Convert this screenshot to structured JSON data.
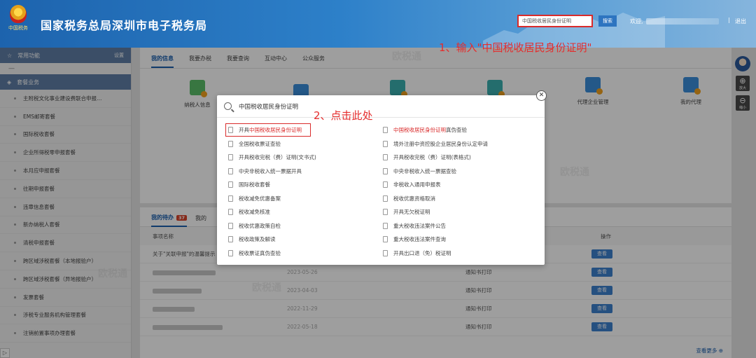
{
  "header": {
    "emblem_text": "中国税务",
    "title": "国家税务总局深圳市电子税务局",
    "search_value": "中国税收居民身份证明",
    "search_button": "搜索",
    "welcome": "欢迎,",
    "separator": "|",
    "logout": "退出"
  },
  "sidebar": {
    "common_label": "常用功能",
    "settings_label": "设置",
    "dash": "—",
    "section_label": "套餐业务",
    "items": [
      "主附税文化事业建设费联合申报…",
      "EMS邮寄套餐",
      "国际税收套餐",
      "企业所得税零申报套餐",
      "本月应申报套餐",
      "往期申报套餐",
      "违章信息套餐",
      "新办纳税人套餐",
      "清税申报套餐",
      "跨区域涉税套餐（本地报验户）",
      "跨区域涉税套餐（异地报验户）",
      "发票套餐",
      "涉税专业服务机构管理套餐",
      "注销前置事项办理套餐"
    ],
    "expand_icon": "▷"
  },
  "main": {
    "tabs": [
      "我的信息",
      "我要办税",
      "我要查询",
      "互动中心",
      "公众服务"
    ],
    "functions": [
      "纳税人信息",
      "",
      "",
      "",
      "代理企业管理",
      "我的代理"
    ],
    "todo_tab": "我的待办",
    "todo_badge": "37",
    "todo_tab2": "我的",
    "table_header": [
      "事项名称",
      "",
      "",
      "操作"
    ],
    "rows": [
      {
        "name": "关于\"关联申报\"的温馨提示",
        "date": "",
        "type": "",
        "action": "查看"
      },
      {
        "name": "",
        "date": "2023-05-26",
        "type": "通知书打印",
        "action": "查看"
      },
      {
        "name": "",
        "date": "2023-04-03",
        "type": "通知书打印",
        "action": "查看"
      },
      {
        "name": "",
        "date": "2022-11-29",
        "type": "通知书打印",
        "action": "查看"
      },
      {
        "name": "",
        "date": "2022-05-18",
        "type": "通知书打印",
        "action": "查看"
      }
    ],
    "more_link": "查看更多 ⊕"
  },
  "right_tools": {
    "zoom_in_label": "放大",
    "zoom_out_label": "缩小"
  },
  "modal": {
    "query": "中国税收居民身份证明",
    "close_glyph": "✕",
    "left_results": [
      {
        "pre": "开具",
        "hl": "中国税收居民身份证明",
        "post": ""
      },
      {
        "pre": "全国税收票证查验",
        "hl": "",
        "post": ""
      },
      {
        "pre": "开具税收完税（费）证明(文书式)",
        "hl": "",
        "post": ""
      },
      {
        "pre": "中央非税收入统一票据开具",
        "hl": "",
        "post": ""
      },
      {
        "pre": "国际税收套餐",
        "hl": "",
        "post": ""
      },
      {
        "pre": "税收减免优惠备案",
        "hl": "",
        "post": ""
      },
      {
        "pre": "税收减免核准",
        "hl": "",
        "post": ""
      },
      {
        "pre": "税收优惠政策自检",
        "hl": "",
        "post": ""
      },
      {
        "pre": "税收政策及解读",
        "hl": "",
        "post": ""
      },
      {
        "pre": "税收票证真伪查验",
        "hl": "",
        "post": ""
      }
    ],
    "right_results": [
      {
        "pre": "",
        "hl": "中国税收居民身份证明",
        "post": "真伪查验"
      },
      {
        "pre": "境外注册中资控股企业居民身份认定申请",
        "hl": "",
        "post": ""
      },
      {
        "pre": "开具税收完税（费）证明(表格式)",
        "hl": "",
        "post": ""
      },
      {
        "pre": "中央非税收入统一票据查验",
        "hl": "",
        "post": ""
      },
      {
        "pre": "非税收入通用申报表",
        "hl": "",
        "post": ""
      },
      {
        "pre": "税收优惠资格取消",
        "hl": "",
        "post": ""
      },
      {
        "pre": "开具无欠税证明",
        "hl": "",
        "post": ""
      },
      {
        "pre": "重大税收违法案件公告",
        "hl": "",
        "post": ""
      },
      {
        "pre": "重大税收违法案件查询",
        "hl": "",
        "post": ""
      },
      {
        "pre": "开具出口退（免）税证明",
        "hl": "",
        "post": ""
      }
    ]
  },
  "annotations": {
    "step1": "1、输入\"中国税收居民身份证明\"",
    "step2": "2、点击此处"
  },
  "colors": {
    "header_blue": "#1d63ad",
    "highlight_red": "#d92b2b",
    "annotation_red": "#e52c2c",
    "sidebar_blue": "#5f7ea6",
    "button_blue": "#3d82cf"
  }
}
